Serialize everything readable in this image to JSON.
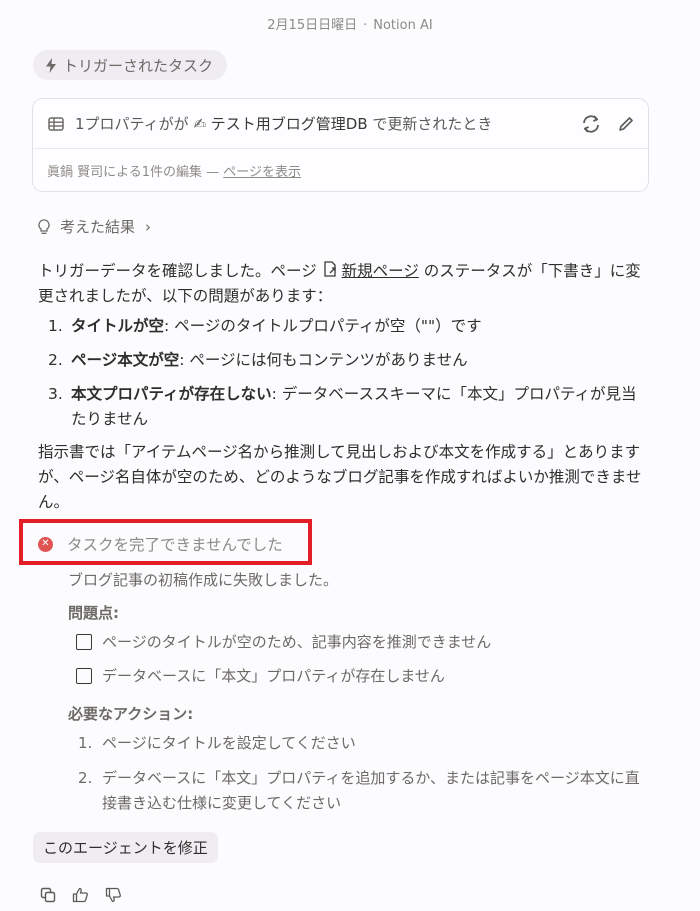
{
  "header": {
    "date": "2月15日日曜日",
    "separator": "·",
    "source": "Notion AI"
  },
  "trigger_chip": {
    "label": "トリガーされたタスク",
    "icon": "lightning-icon"
  },
  "trigger_card": {
    "prefix": "1プロパティがが",
    "db_emoji": "✍",
    "db_name": "テスト用ブログ管理DB",
    "suffix": "で更新されたとき",
    "edit_info": "眞鍋 賢司による1件の編集 — ",
    "view_link": "ページを表示"
  },
  "thought": {
    "label": "考えた結果",
    "chevron": "›"
  },
  "message": {
    "p1_a": "トリガーデータを確認しました。ページ ",
    "p1_page": "新規ページ",
    "p1_b": " のステータスが「下書き」に変更されましたが、以下の問題があります：",
    "issues": [
      {
        "num": "1.",
        "title": "タイトルが空",
        "desc": ": ページのタイトルプロパティが空（\"\"）です"
      },
      {
        "num": "2.",
        "title": "ページ本文が空",
        "desc": ": ページには何もコンテンツがありません"
      },
      {
        "num": "3.",
        "title": "本文プロパティが存在しない",
        "desc": ": データベーススキーマに「本文」プロパティが見当たりません"
      }
    ],
    "p2": "指示書では「アイテムページ名から推測して見出しおよび本文を作成する」とありますが、ページ名自体が空のため、どのようなブログ記事を作成すればよいか推測できません。"
  },
  "error": {
    "title": "タスクを完了できませんでした",
    "summary": "ブログ記事の初稿作成に失敗しました。",
    "problems_heading": "問題点:",
    "problems": [
      "ページのタイトルが空のため、記事内容を推測できません",
      "データベースに「本文」プロパティが存在しません"
    ],
    "actions_heading": "必要なアクション:",
    "actions": [
      {
        "num": "1.",
        "text": "ページにタイトルを設定してください"
      },
      {
        "num": "2.",
        "text": "データベースに「本文」プロパティを追加するか、または記事をページ本文に直接書き込む仕様に変更してください"
      }
    ]
  },
  "buttons": {
    "fix_agent": "このエージェントを修正"
  },
  "colors": {
    "error_red": "#e05454",
    "highlight_box": "#e41e26",
    "chip_bg": "#efedf1"
  }
}
